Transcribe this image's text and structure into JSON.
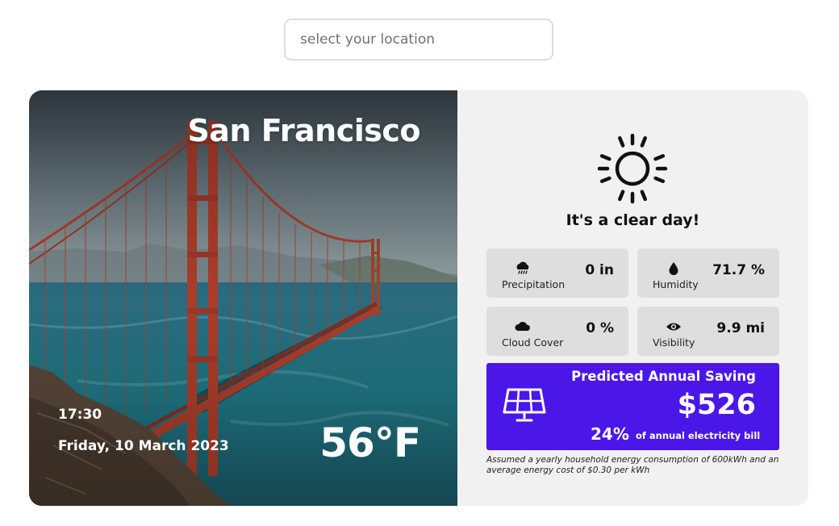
{
  "search": {
    "placeholder": "select your location",
    "value": ""
  },
  "location": {
    "city": "San Francisco",
    "time": "17:30",
    "date": "Friday, 10 March 2023",
    "temperature": "56°F",
    "background_image": "golden-gate-bridge-photo"
  },
  "weather": {
    "icon": "sun-icon",
    "summary": "It's a clear day!",
    "stats": [
      {
        "icon": "rain-cloud-icon",
        "label": "Precipitation",
        "value": "0 in"
      },
      {
        "icon": "droplet-icon",
        "label": "Humidity",
        "value": "71.7 %"
      },
      {
        "icon": "cloud-icon",
        "label": "Cloud Cover",
        "value": "0 %"
      },
      {
        "icon": "eye-icon",
        "label": "Visibility",
        "value": "9.9 mi"
      }
    ]
  },
  "saving": {
    "icon": "solar-panel-icon",
    "title": "Predicted Annual Saving",
    "amount": "$526",
    "percent": "24%",
    "percent_description": "of annual electricity bill",
    "footnote": "Assumed a yearly household energy consumption of 600kWh and an average energy cost of $0.30 per kWh"
  },
  "colors": {
    "saving_background": "#4a17e8",
    "info_panel_background": "#f1f1f1",
    "stat_tile_background": "#dedede",
    "bridge_red": "#b5402c"
  }
}
